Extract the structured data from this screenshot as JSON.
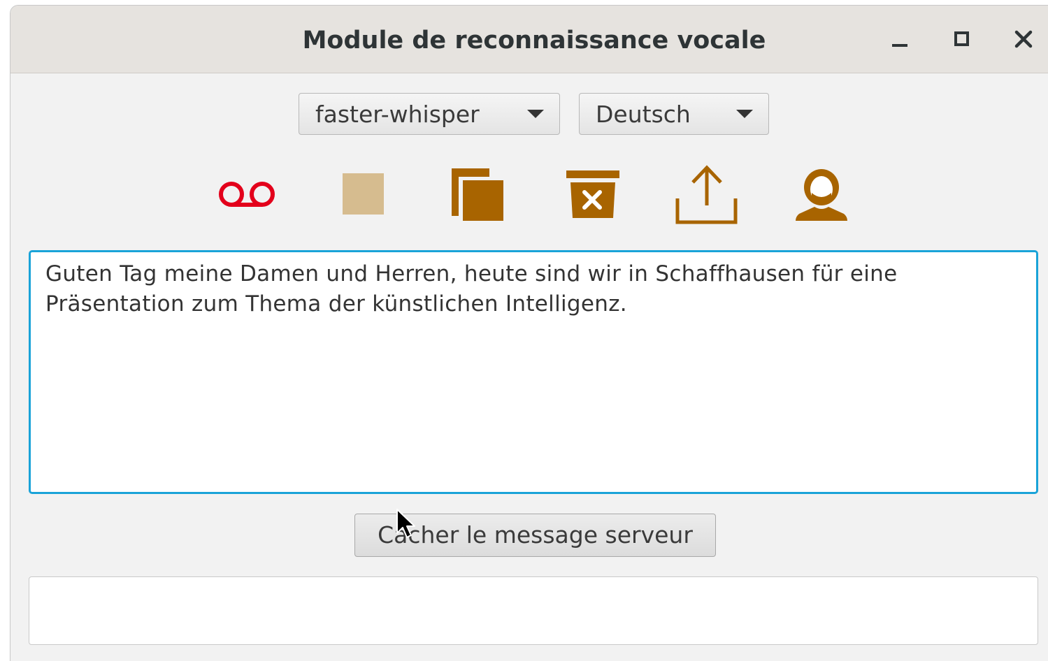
{
  "window": {
    "title": "Module de reconnaissance vocale",
    "controls": {
      "minimize": "minimize-icon",
      "maximize": "maximize-icon",
      "close": "close-icon"
    }
  },
  "selectors": {
    "model": {
      "value": "faster-whisper"
    },
    "language": {
      "value": "Deutsch"
    }
  },
  "toolbar": {
    "icons": [
      "voicemail-record-icon",
      "stop-icon",
      "copy-icon",
      "delete-icon",
      "upload-icon",
      "user-icon"
    ],
    "colors": {
      "record": "#e3001b",
      "stop": "#d6bc8f",
      "accent": "#a86400"
    }
  },
  "transcript": {
    "text": "Guten Tag meine Damen und Herren, heute sind wir in Schaffhausen für eine Präsentation zum Thema der künstlichen Intelligenz."
  },
  "server": {
    "toggle_label": "Cacher le message serveur",
    "message": ""
  }
}
